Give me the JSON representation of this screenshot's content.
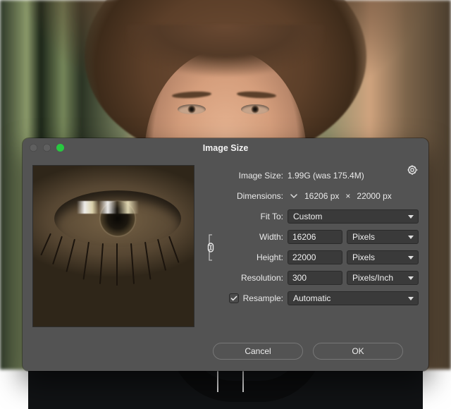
{
  "dialog": {
    "title": "Image Size",
    "image_size_label": "Image Size:",
    "image_size_value": "1.99G (was 175.4M)",
    "dimensions_label": "Dimensions:",
    "dimensions_w": "16206 px",
    "dimensions_h": "22000 px",
    "dimensions_sep": "×",
    "fit_to_label": "Fit To:",
    "fit_to_value": "Custom",
    "width_label": "Width:",
    "width_value": "16206",
    "height_label": "Height:",
    "height_value": "22000",
    "wh_unit": "Pixels",
    "resolution_label": "Resolution:",
    "resolution_value": "300",
    "resolution_unit": "Pixels/Inch",
    "resample_label": "Resample:",
    "resample_checked": true,
    "resample_value": "Automatic",
    "cancel": "Cancel",
    "ok": "OK"
  }
}
